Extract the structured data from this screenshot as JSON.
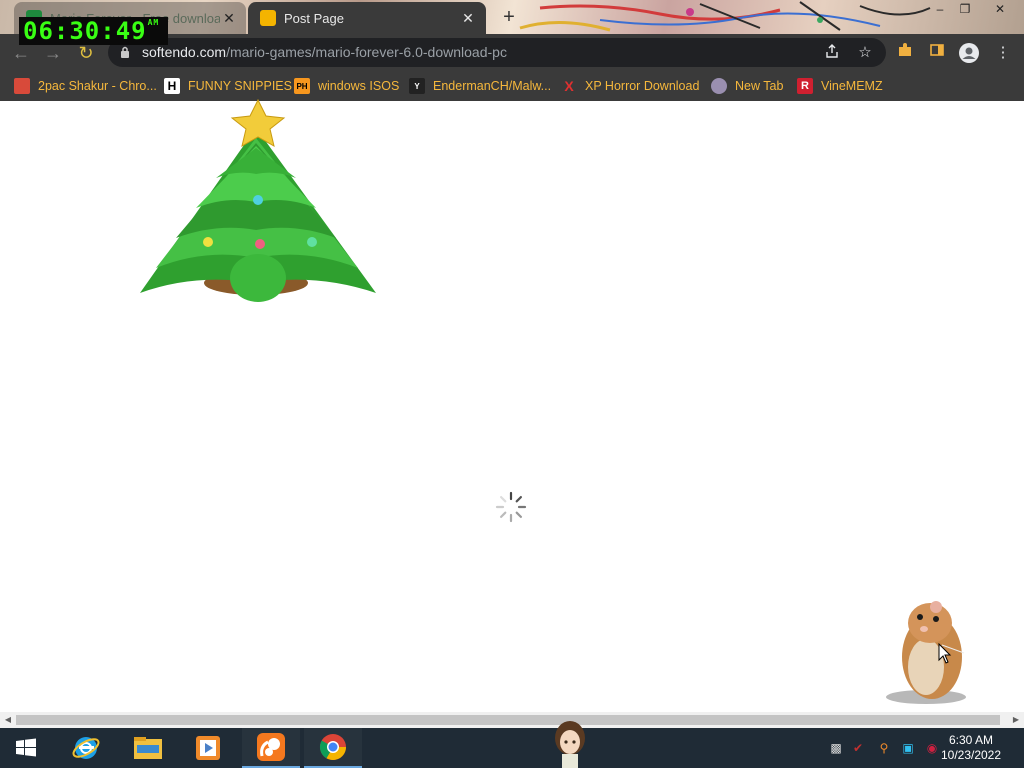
{
  "browser": {
    "tabs": [
      {
        "title": "Mario Forever - Free download a",
        "active": false,
        "favicon": "spreadsheet-icon"
      },
      {
        "title": "Post Page",
        "active": true,
        "favicon": "cat-icon"
      }
    ],
    "close_glyph": "✕",
    "new_tab_glyph": "+",
    "window_controls": [
      "–",
      "❐",
      "✕"
    ],
    "address": {
      "domain": "softendo.com",
      "path": "/mario-games/mario-forever-6.0-download-pc"
    },
    "nav_glyphs": {
      "back": "←",
      "forward": "→",
      "reload": "↻"
    },
    "bookmarks": [
      {
        "label": "2pac Shakur - Chro...",
        "icon": "gift-icon"
      },
      {
        "label": "FUNNY SNIPPIES",
        "icon": "h-logo-icon",
        "icon_text": "H"
      },
      {
        "label": "windows ISOS",
        "icon": "ph-logo-icon",
        "icon_text": "PH"
      },
      {
        "label": "EndermanCH/Malw...",
        "icon": "youtube-logo-icon",
        "icon_text": "Y"
      },
      {
        "label": "XP Horror Download",
        "icon": "x-logo-icon",
        "icon_text": "X"
      },
      {
        "label": "New Tab",
        "icon": "globe-icon"
      },
      {
        "label": "VineMEMZ",
        "icon": "r-logo-icon",
        "icon_text": "R"
      }
    ]
  },
  "clock_overlay": {
    "time": "06:30:49",
    "ampm": "AM"
  },
  "taskbar": {
    "apps": [
      {
        "name": "start-button"
      },
      {
        "name": "internet-explorer"
      },
      {
        "name": "file-explorer"
      },
      {
        "name": "media-player"
      },
      {
        "name": "uc-browser",
        "running": true
      },
      {
        "name": "google-chrome",
        "running": true
      }
    ],
    "time": "6:30 AM",
    "date": "10/23/2022"
  },
  "colors": {
    "chrome_bg": "#3a3a3a",
    "omnibox_bg": "#202124",
    "bookmark_text": "#f6b83c",
    "clock_green": "#39ff14",
    "taskbar_bg": "#1f2b36"
  }
}
